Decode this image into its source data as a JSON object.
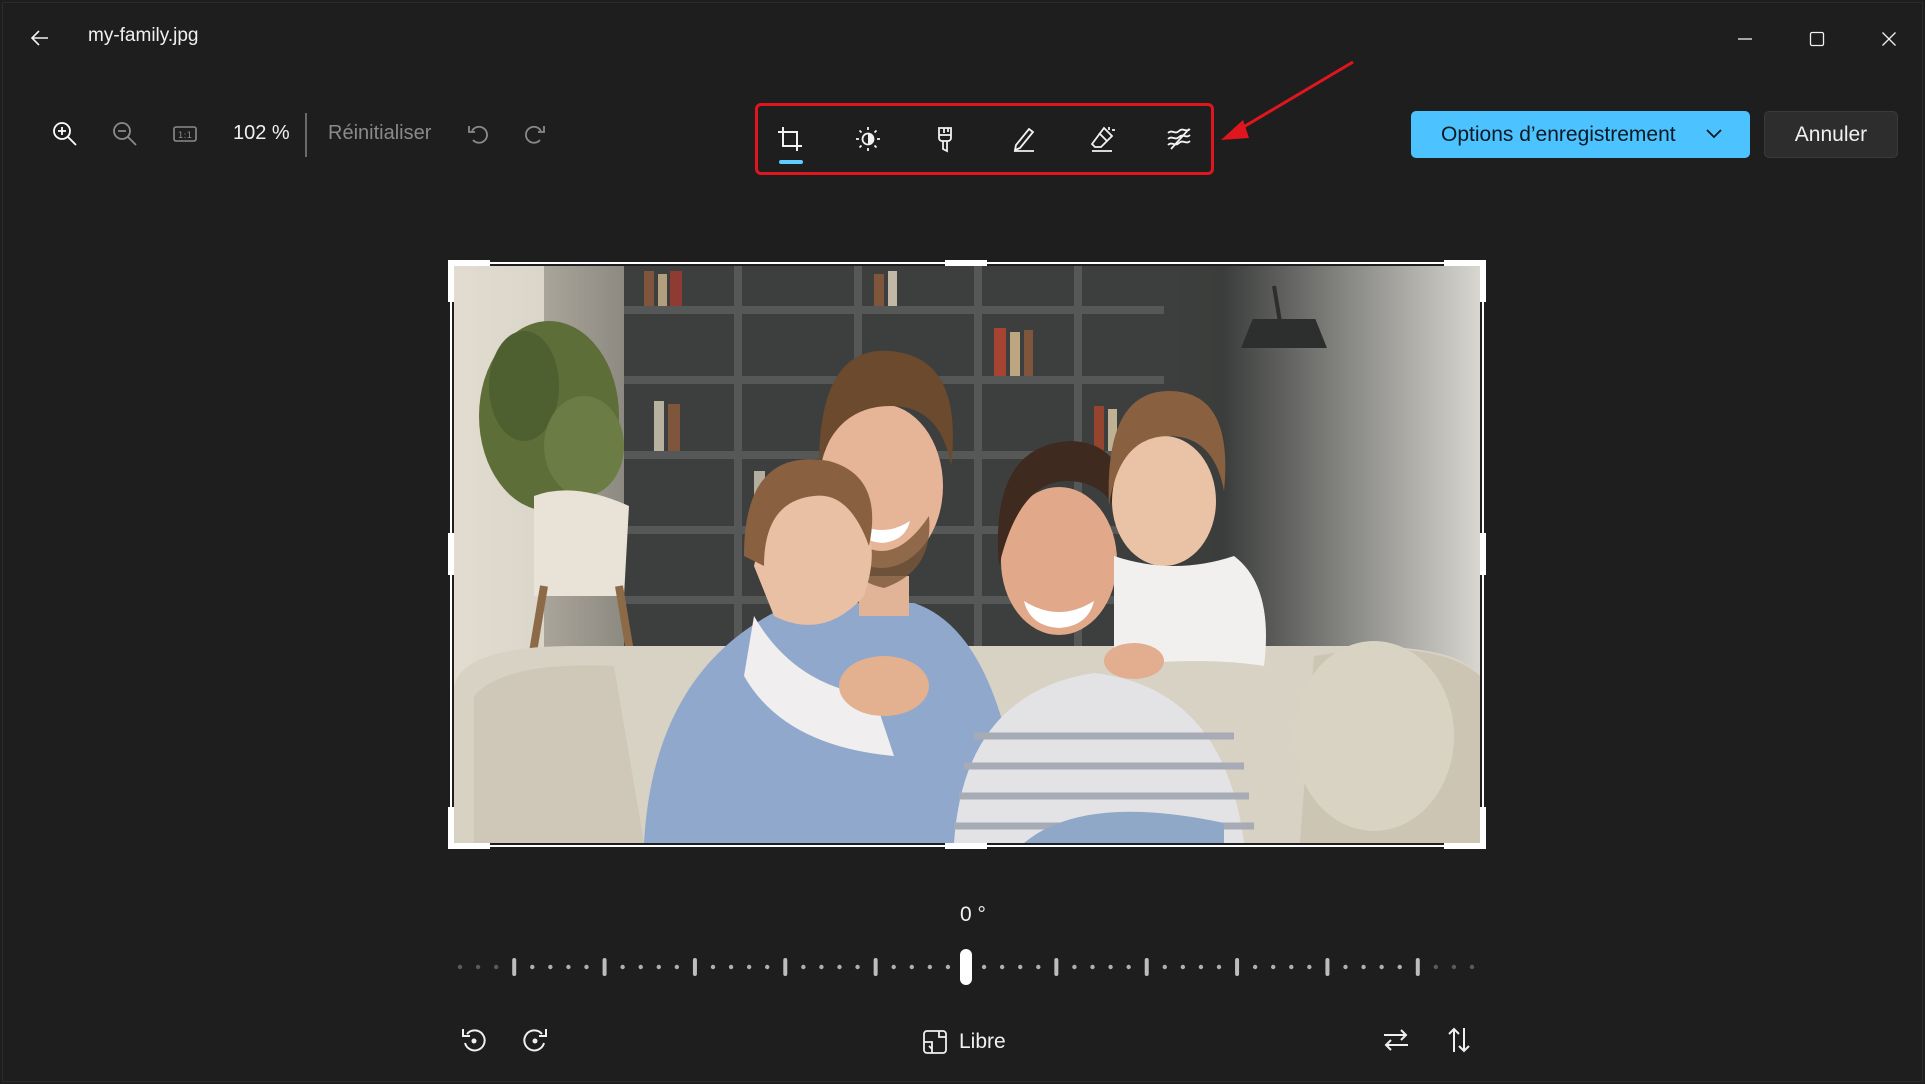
{
  "window": {
    "title": "my-family.jpg"
  },
  "toolbar": {
    "zoom_percent": "102 %",
    "reset_label": "Réinitialiser",
    "left_icons": [
      "zoom-in-icon",
      "zoom-out-icon",
      "actual-size-icon",
      "undo-icon",
      "redo-icon"
    ]
  },
  "edit_tools": {
    "items": [
      "crop",
      "adjustment",
      "filter",
      "markup",
      "erase",
      "background-blur"
    ],
    "active": "crop"
  },
  "actions": {
    "save_label": "Options d’enregistrement",
    "cancel_label": "Annuler"
  },
  "rotation": {
    "angle_label": "0 °",
    "value": 0
  },
  "aspect": {
    "label": "Libre"
  },
  "colors": {
    "accent": "#4cc2ff",
    "annotation": "#e0161e",
    "background": "#1e1e1e"
  }
}
